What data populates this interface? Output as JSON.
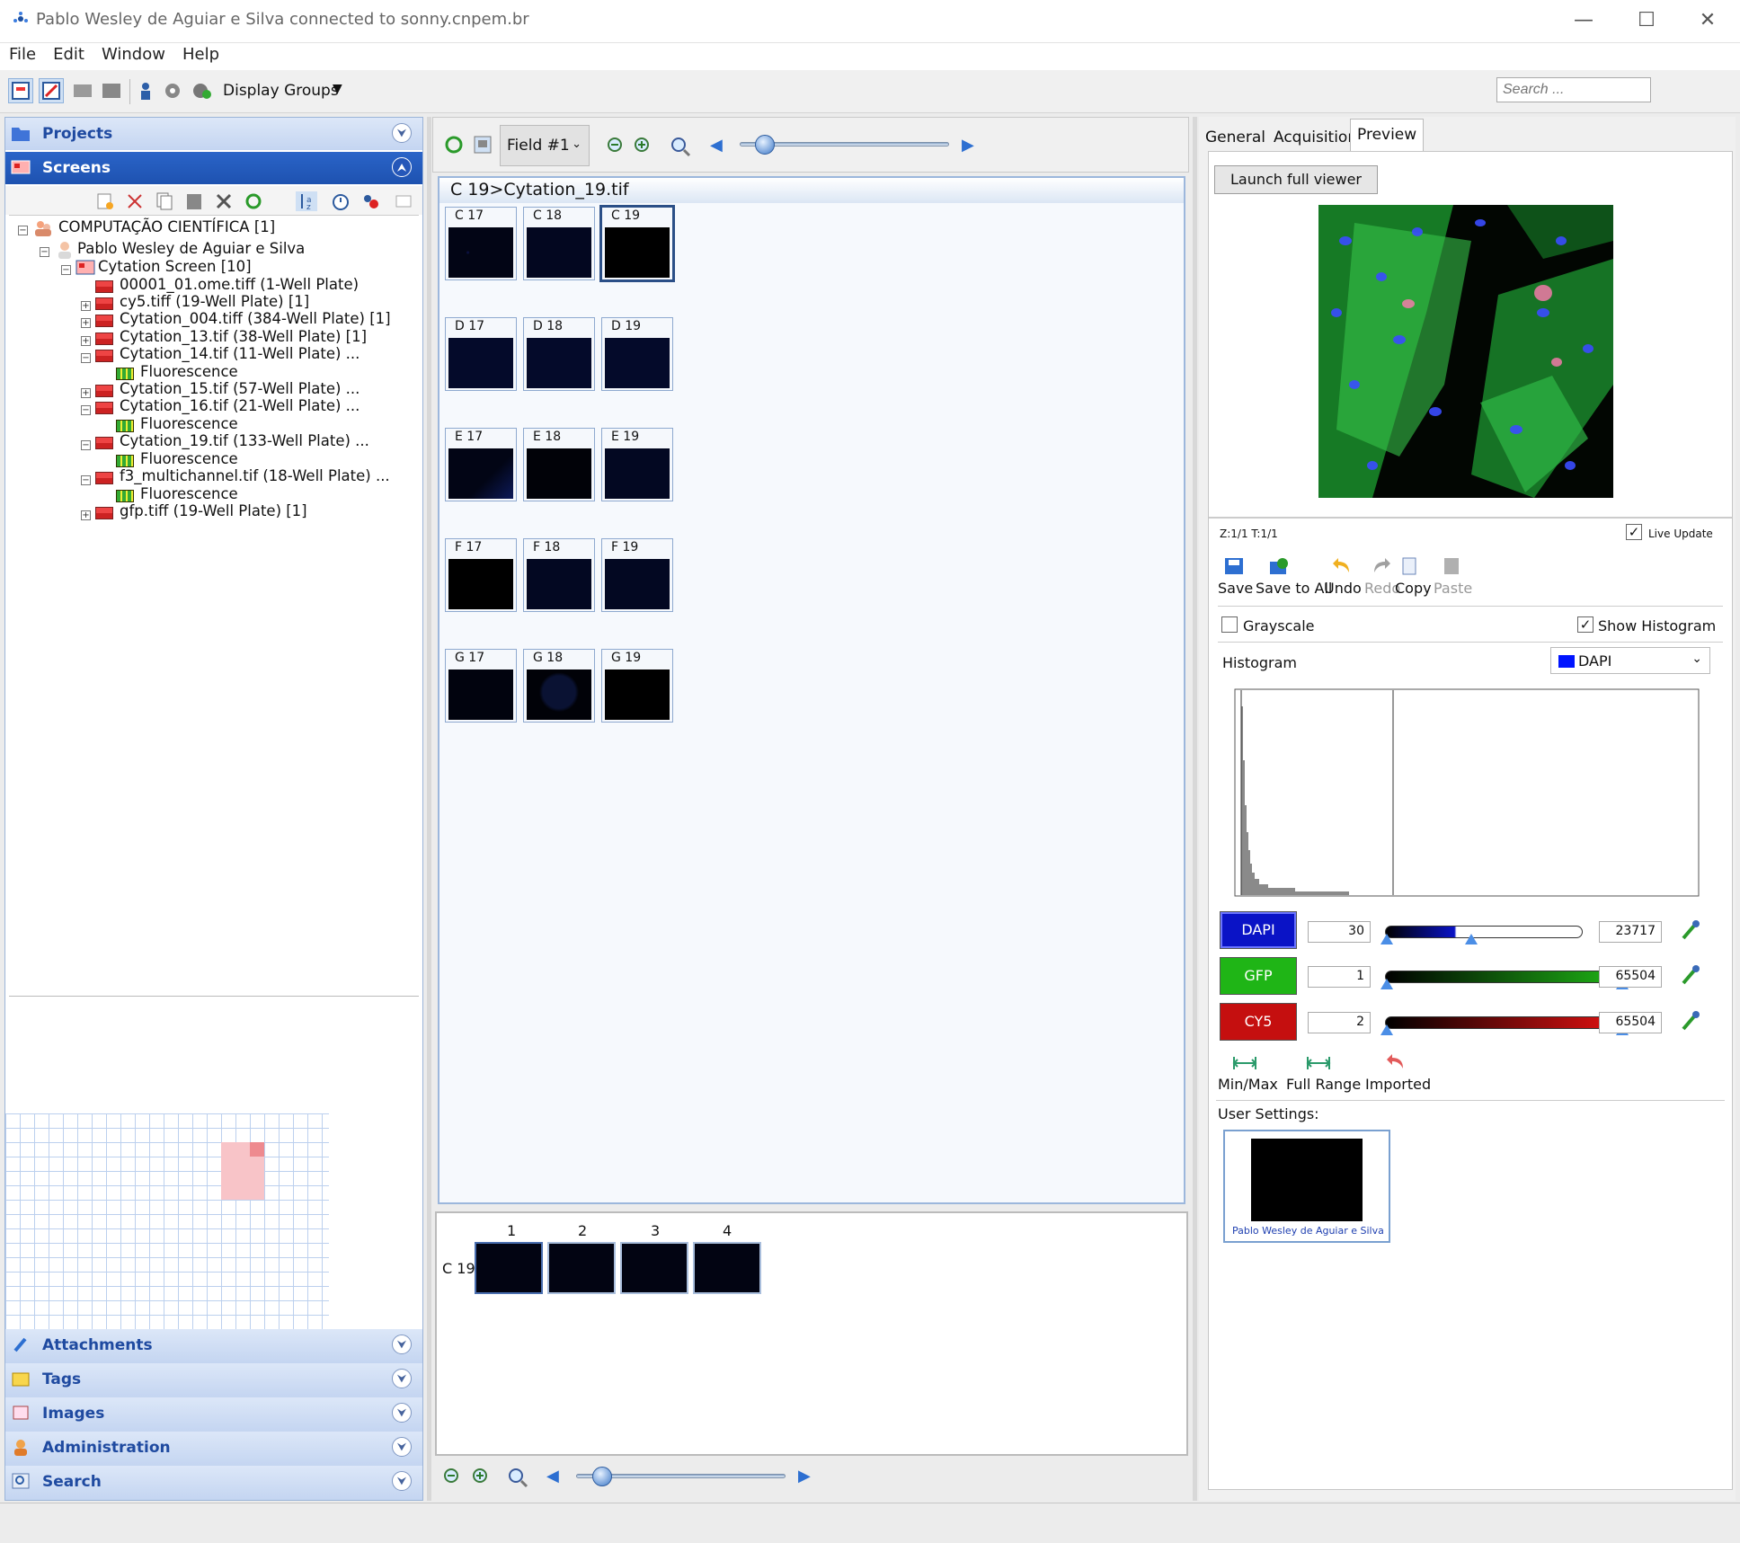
{
  "window": {
    "title": "Pablo Wesley de Aguiar e Silva connected to sonny.cnpem.br",
    "minimize": "—",
    "maximize": "☐",
    "close": "✕"
  },
  "menu": [
    "File",
    "Edit",
    "Window",
    "Help"
  ],
  "toolbar": {
    "display_groups": "Display Groups",
    "search_placeholder": "Search ..."
  },
  "left": {
    "projects": "Projects",
    "screens": "Screens",
    "tree": [
      {
        "label": "COMPUTAÇÃO CIENTÍFICA [1]"
      },
      {
        "label": "Pablo Wesley de Aguiar e Silva"
      },
      {
        "label": "Cytation Screen [10]"
      },
      {
        "label": "00001_01.ome.tiff (1-Well Plate)"
      },
      {
        "label": "cy5.tiff (19-Well Plate) [1]"
      },
      {
        "label": "Cytation_004.tiff (384-Well Plate) [1]"
      },
      {
        "label": "Cytation_13.tif (38-Well Plate) [1]"
      },
      {
        "label": "Cytation_14.tif (11-Well Plate) ..."
      },
      {
        "label": "Fluorescence"
      },
      {
        "label": "Cytation_15.tif (57-Well Plate) ..."
      },
      {
        "label": "Cytation_16.tif (21-Well Plate) ..."
      },
      {
        "label": "Fluorescence"
      },
      {
        "label": "Cytation_19.tif (133-Well Plate) ..."
      },
      {
        "label": "Fluorescence"
      },
      {
        "label": "f3_multichannel.tif (18-Well Plate) ..."
      },
      {
        "label": "Fluorescence"
      },
      {
        "label": "gfp.tiff (19-Well Plate) [1]"
      }
    ],
    "bottom_panels": [
      "Attachments",
      "Tags",
      "Images",
      "Administration",
      "Search"
    ]
  },
  "center": {
    "field_select": "Field #1",
    "breadcrumb": "C 19>Cytation_19.tif",
    "wells": [
      [
        "C 17",
        "C 18",
        "C 19"
      ],
      [
        "D 17",
        "D 18",
        "D 19"
      ],
      [
        "E 17",
        "E 18",
        "E 19"
      ],
      [
        "F 17",
        "F 18",
        "F 19"
      ],
      [
        "G 17",
        "G 18",
        "G 19"
      ]
    ],
    "fields_row_label": "C 19",
    "field_numbers": [
      "1",
      "2",
      "3",
      "4"
    ]
  },
  "right": {
    "tabs": [
      "General",
      "Acquisition",
      "Preview"
    ],
    "launch_full_viewer": "Launch full viewer",
    "zt_label": "Z:1/1 T:1/1",
    "live_update": "Live Update",
    "actions": [
      "Save",
      "Save to All",
      "Undo",
      "Redo",
      "Copy",
      "Paste"
    ],
    "grayscale": "Grayscale",
    "show_histogram": "Show Histogram",
    "histogram_label": "Histogram",
    "histogram_channel": "DAPI",
    "channels": [
      {
        "name": "DAPI",
        "min": "30",
        "max": "23717",
        "color": "#0a13c6"
      },
      {
        "name": "GFP",
        "min": "1",
        "max": "65504",
        "color": "#1fb516"
      },
      {
        "name": "CY5",
        "min": "2",
        "max": "65504",
        "color": "#c50f0f"
      }
    ],
    "range_buttons": [
      "Min/Max",
      "Full Range",
      "Imported"
    ],
    "user_settings_label": "User Settings:",
    "user_settings_owner": "Pablo Wesley de Aguiar e Silva"
  }
}
